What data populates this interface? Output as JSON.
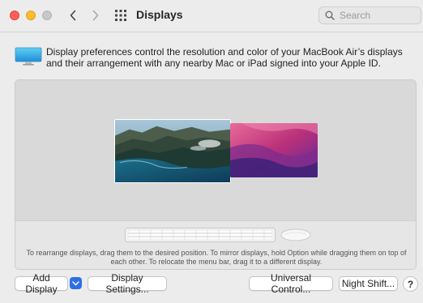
{
  "window": {
    "title": "Displays"
  },
  "search": {
    "placeholder": "Search"
  },
  "info": {
    "text": "Display preferences control the resolution and color of your MacBook Air’s displays and their arrangement with any nearby Mac or iPad signed into your Apple ID."
  },
  "arrangement": {
    "hint": "To rearrange displays, drag them to the desired position. To mirror displays, hold Option while dragging them on top of each other. To relocate the menu bar, drag it to a different display."
  },
  "buttons": {
    "add_display": "Add Display",
    "display_settings": "Display Settings...",
    "universal_control": "Universal Control...",
    "night_shift": "Night Shift...",
    "help": "?"
  },
  "icons": {
    "close": "close-traffic-light",
    "minimize": "minimize-traffic-light",
    "zoom": "zoom-traffic-light",
    "back": "chevron-left-icon",
    "forward": "chevron-right-icon",
    "show_all": "grid-icon",
    "search": "magnifier-icon",
    "display": "display-icon",
    "dropdown": "chevron-down-icon"
  },
  "colors": {
    "accent": "#2e6fe6",
    "close": "#fe5f57",
    "minimize": "#febc2e",
    "zoom_inactive": "#c8c8c8"
  }
}
